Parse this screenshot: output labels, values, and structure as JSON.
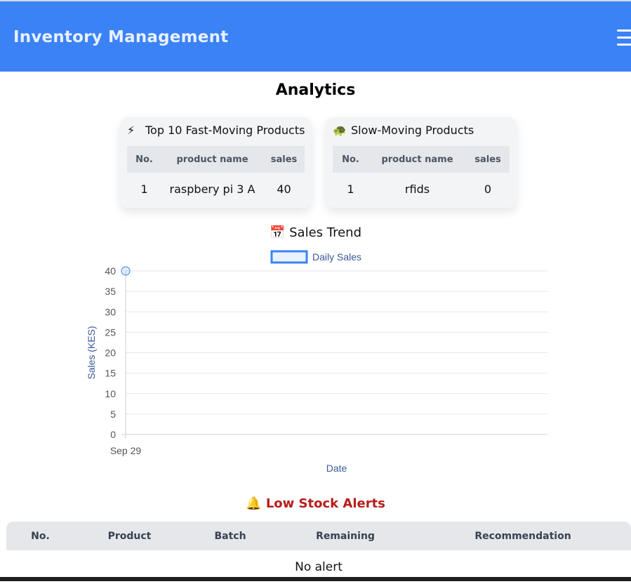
{
  "header": {
    "title": "Inventory Management",
    "menu_icon": "hamburger-icon"
  },
  "page": {
    "title": "Analytics"
  },
  "fast_moving": {
    "icon": "⚡",
    "title": "Top 10 Fast-Moving Products",
    "columns": [
      "No.",
      "product name",
      "sales"
    ],
    "rows": [
      {
        "no": "1",
        "name": "raspbery pi 3 A",
        "sales": "40"
      }
    ]
  },
  "slow_moving": {
    "icon": "🐢",
    "title": "Slow-Moving Products",
    "columns": [
      "No.",
      "product name",
      "sales"
    ],
    "rows": [
      {
        "no": "1",
        "name": "rfids",
        "sales": "0"
      }
    ]
  },
  "sales_trend": {
    "icon": "📅",
    "title": "Sales Trend"
  },
  "chart_data": {
    "type": "line",
    "x": [
      "Sep 29"
    ],
    "series": [
      {
        "name": "Daily Sales",
        "values": [
          40
        ],
        "color": "#3b82f6"
      }
    ],
    "xlabel": "Date",
    "ylabel": "Sales (KES)",
    "ylim": [
      0,
      40
    ],
    "yticks": [
      0,
      5,
      10,
      15,
      20,
      25,
      30,
      35,
      40
    ],
    "grid": true,
    "legend": "top-center"
  },
  "alerts": {
    "icon": "🔔",
    "title": "Low Stock Alerts",
    "columns": [
      "No.",
      "Product",
      "Batch",
      "Remaining",
      "Recommendation"
    ],
    "empty_text": "No alert"
  },
  "colors": {
    "header": "#3b82f6",
    "alert": "#b91c1c",
    "line": "#3b82f6"
  }
}
